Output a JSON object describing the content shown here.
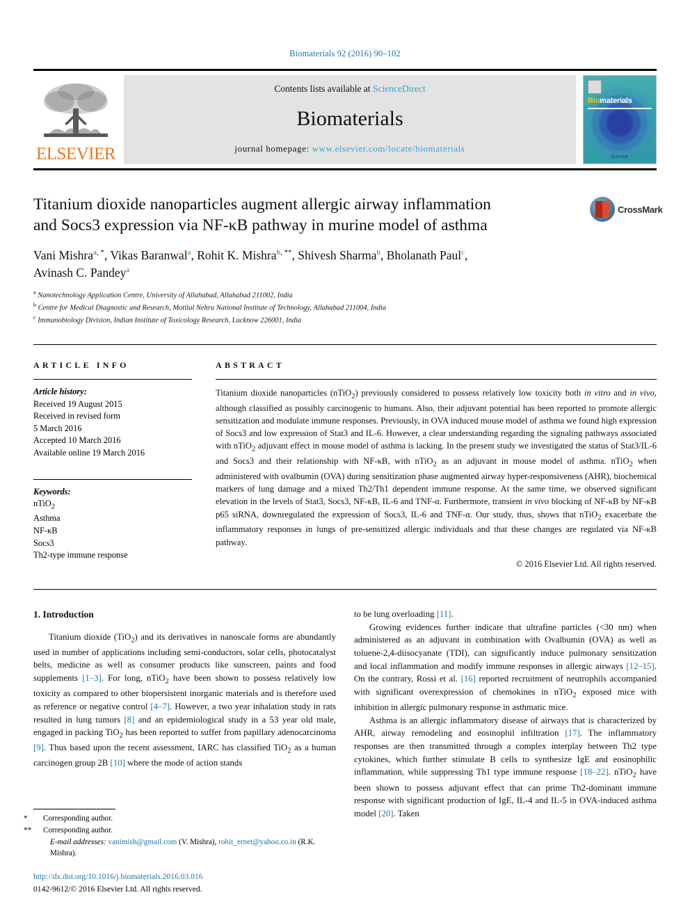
{
  "running_head": "Biomaterials 92 (2016) 90–102",
  "masthead": {
    "publisher": "ELSEVIER",
    "contents_prefix": "Contents lists available at ",
    "contents_link": "ScienceDirect",
    "journal_name": "Biomaterials",
    "homepage_prefix": "journal homepage: ",
    "homepage_url": "www.elsevier.com/locate/biomaterials",
    "cover": {
      "title_part1": "Bio",
      "title_part2": "materials",
      "footer": "ELSEVIER"
    }
  },
  "article": {
    "title_line1": "Titanium dioxide nanoparticles augment allergic airway inflammation",
    "title_line2": "and Socs3 expression via NF-κB pathway in murine model of asthma",
    "crossmark_label": "CrossMark",
    "authors": [
      {
        "name": "Vani Mishra",
        "affil": "a",
        "mark": ", *",
        "sep": ", "
      },
      {
        "name": "Vikas Baranwal",
        "affil": "a",
        "mark": "",
        "sep": ", "
      },
      {
        "name": "Rohit K. Mishra",
        "affil": "b",
        "mark": ", **",
        "sep": ", "
      },
      {
        "name": "Shivesh Sharma",
        "affil": "b",
        "mark": "",
        "sep": ", "
      },
      {
        "name": "Bholanath Paul",
        "affil": "c",
        "mark": "",
        "sep": ", "
      },
      {
        "name": "Avinash C. Pandey",
        "affil": "a",
        "mark": "",
        "sep": ""
      }
    ],
    "affiliations": [
      {
        "key": "a",
        "text": "Nanotechnology Application Centre, University of Allahabad, Allahabad 211002, India"
      },
      {
        "key": "b",
        "text": "Centre for Medical Diagnostic and Research, Motilal Nehru National Institute of Technology, Allahabad 211004, India"
      },
      {
        "key": "c",
        "text": "Immunobiology Division, Indian Institute of Toxicology Research, Lucknow 226001, India"
      }
    ]
  },
  "article_info": {
    "heading": "ARTICLE INFO",
    "history_label": "Article history:",
    "history": [
      "Received 19 August 2015",
      "Received in revised form",
      "5 March 2016",
      "Accepted 10 March 2016",
      "Available online 19 March 2016"
    ],
    "keywords_label": "Keywords:",
    "keywords": [
      "nTiO2",
      "Asthma",
      "NF-κB",
      "Socs3",
      "Th2-type immune response"
    ]
  },
  "abstract": {
    "heading": "ABSTRACT",
    "text": "Titanium dioxide nanoparticles (nTiO2) previously considered to possess relatively low toxicity both in vitro and in vivo, although classified as possibly carcinogenic to humans. Also, their adjuvant potential has been reported to promote allergic sensitization and modulate immune responses. Previously, in OVA induced mouse model of asthma we found high expression of Socs3 and low expression of Stat3 and IL-6. However, a clear understanding regarding the signaling pathways associated with nTiO2 adjuvant effect in mouse model of asthma is lacking. In the present study we investigated the status of Stat3/IL-6 and Socs3 and their relationship with NF-κB, with nTiO2 as an adjuvant in mouse model of asthma. nTiO2 when administered with ovalbumin (OVA) during sensitization phase augmented airway hyper-responsiveness (AHR), biochemical markers of lung damage and a mixed Th2/Th1 dependent immune response. At the same time, we observed significant elevation in the levels of Stat3, Socs3, NF-κB, IL-6 and TNF-α. Furthermore, transient in vivo blocking of NF-κB by NF-κB p65 siRNA, downregulated the expression of Socs3, IL-6 and TNF-α. Our study, thus, shows that nTiO2 exacerbate the inflammatory responses in lungs of pre-sensitized allergic individuals and that these changes are regulated via NF-κB pathway.",
    "copyright": "© 2016 Elsevier Ltd. All rights reserved."
  },
  "introduction": {
    "heading": "1. Introduction",
    "left_paragraphs": [
      "Titanium dioxide (TiO2) and its derivatives in nanoscale forms are abundantly used in number of applications including semi-conductors, solar cells, photocatalyst belts, medicine as well as consumer products like sunscreen, paints and food supplements [1–3]. For long, nTiO2 have been shown to possess relatively low toxicity as compared to other biopersistent inorganic materials and is therefore used as reference or negative control [4–7]. However, a two year inhalation study in rats resulted in lung tumors [8] and an epidemiological study in a 53 year old male, engaged in packing TiO2 has been reported to suffer from papillary adenocarcinoma [9]. Thus based upon the recent assessment, IARC has classified TiO2 as a human carcinogen group 2B [10] where the mode of action stands"
    ],
    "right_paragraphs": [
      "to be lung overloading [11].",
      "Growing evidences further indicate that ultrafine particles (<30 nm) when administered as an adjuvant in combination with Ovalbumin (OVA) as well as toluene-2,4-diisocyanate (TDI), can significantly induce pulmonary sensitization and local inflammation and modify immune responses in allergic airways [12–15]. On the contrary, Rossi et al. [16] reported recruitment of neutrophils accompanied with significant overexpression of chemokines in nTiO2 exposed mice with inhibition in allergic pulmonary response in asthmatic mice.",
      "Asthma is an allergic inflammatory disease of airways that is characterized by AHR, airway remodeling and eosinophil infiltration [17]. The inflammatory responses are then transmitted through a complex interplay between Th2 type cytokines, which further stimulate B cells to synthesize IgE and eosinophilic inflammation, while suppressing Th1 type immune response [18–22]. nTiO2 have been shown to possess adjuvant effect that can prime Th2-dominant immune response with significant production of IgE, IL-4 and IL-5 in OVA-induced asthma model [20]. Taken"
    ]
  },
  "footnotes": {
    "corresponding_1": "Corresponding author.",
    "corresponding_2": "Corresponding author.",
    "email_label": "E-mail addresses:",
    "email_1": "vanimish@gmail.com",
    "email_1_owner": "(V. Mishra),",
    "email_2": "rohit_ernet@yahoo.co.in",
    "email_2_owner": "(R.K. Mishra).",
    "doi": "http://dx.doi.org/10.1016/j.biomaterials.2016.03.016",
    "issn_line": "0142-9612/© 2016 Elsevier Ltd. All rights reserved."
  },
  "colors": {
    "link": "#1b75a8",
    "science_direct": "#2ea3d6",
    "elsevier_orange": "#E87722",
    "band_gray": "#e3e3e3"
  }
}
